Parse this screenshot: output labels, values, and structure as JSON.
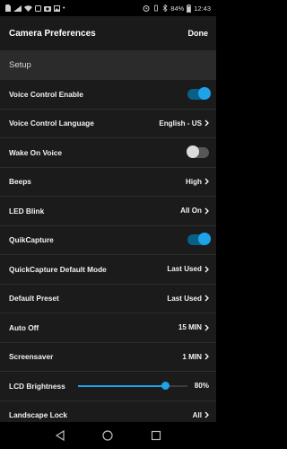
{
  "status_bar": {
    "battery_percent": "84%",
    "time": "12:43"
  },
  "app_bar": {
    "title": "Camera Preferences",
    "done_label": "Done"
  },
  "section": {
    "title": "Setup"
  },
  "rows": [
    {
      "label": "Voice Control Enable",
      "type": "toggle",
      "on": true
    },
    {
      "label": "Voice Control Language",
      "type": "value",
      "value": "English - US"
    },
    {
      "label": "Wake On Voice",
      "type": "toggle",
      "on": false
    },
    {
      "label": "Beeps",
      "type": "value",
      "value": "High"
    },
    {
      "label": "LED Blink",
      "type": "value",
      "value": "All On"
    },
    {
      "label": "QuikCapture",
      "type": "toggle",
      "on": true
    },
    {
      "label": "QuickCapture Default Mode",
      "type": "value",
      "value": "Last Used"
    },
    {
      "label": "Default Preset",
      "type": "value",
      "value": "Last Used"
    },
    {
      "label": "Auto Off",
      "type": "value",
      "value": "15 MIN"
    },
    {
      "label": "Screensaver",
      "type": "value",
      "value": "1 MIN"
    },
    {
      "label": "LCD Brightness",
      "type": "slider",
      "value": "80%",
      "level": 0.8
    },
    {
      "label": "Landscape Lock",
      "type": "value",
      "value": "All"
    }
  ],
  "colors": {
    "accent": "#1ea3e8",
    "toggle_on_track": "#0a5f86",
    "row_bg": "#1b1b1b",
    "section_bg": "#2b2b2b",
    "app_bar_bg": "#1a1a1a"
  },
  "nav_bar": {
    "icons": [
      "back-icon",
      "home-icon",
      "recents-icon"
    ]
  }
}
